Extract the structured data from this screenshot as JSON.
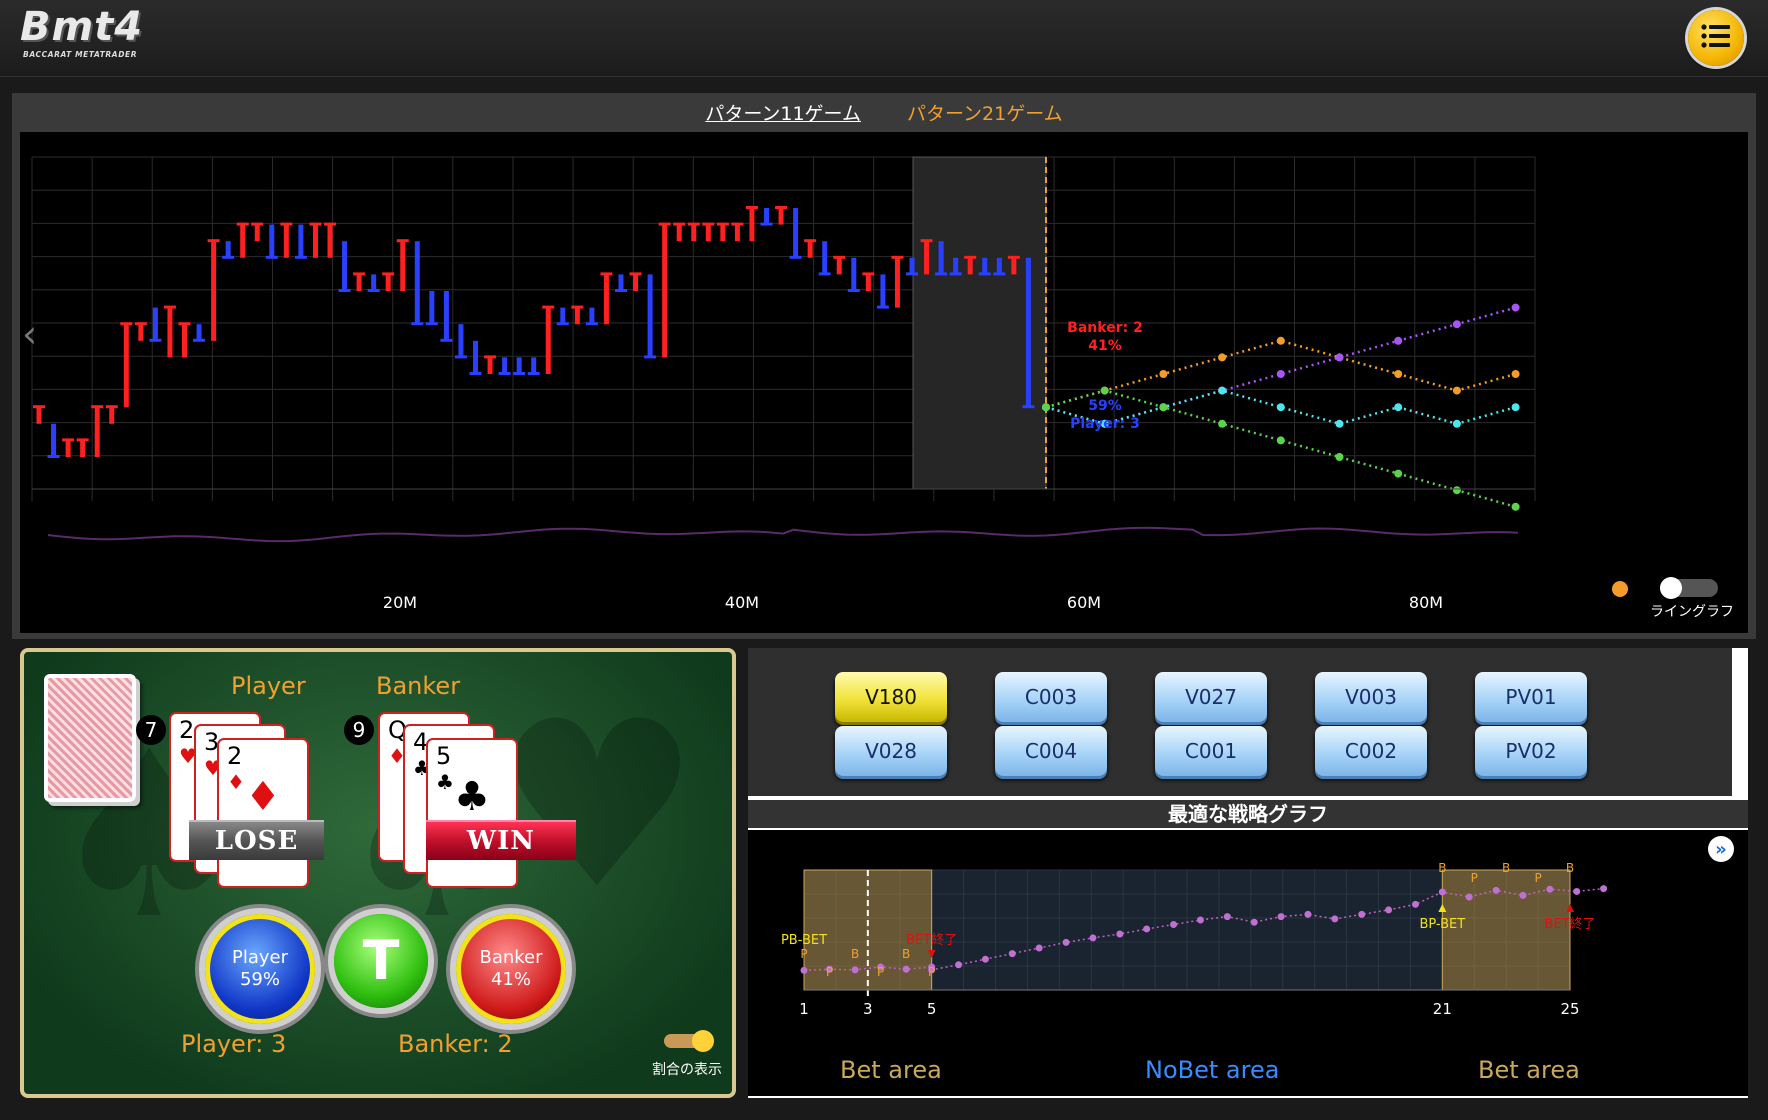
{
  "app": {
    "logo_main": "Bmt4",
    "logo_sub": "BACCARAT METATRADER",
    "menu_icon": "menu-list-icon"
  },
  "top_chart": {
    "tabs": [
      {
        "label": "パターン11ゲーム",
        "active": true
      },
      {
        "label": "パターン21ゲーム",
        "active": false
      }
    ],
    "x_ticks": [
      "20M",
      "40M",
      "60M",
      "80M"
    ],
    "toggle_label": "ライングラフ",
    "banker_annotation": {
      "name": "Banker: 2",
      "pct": "41%"
    },
    "player_annotation": {
      "pct": "59%",
      "name": "Player: 3"
    },
    "colors": {
      "banker": "#ff2020",
      "player": "#2a40ff",
      "orange": "#f39c2a",
      "purple": "#a855f7",
      "cyan": "#4ee6ec",
      "green": "#5bd34a"
    }
  },
  "chart_data": {
    "type": "line",
    "bars": [
      {
        "c": "r",
        "lo": 6,
        "hi": 7
      },
      {
        "c": "b",
        "lo": 4,
        "hi": 6
      },
      {
        "c": "r",
        "lo": 4,
        "hi": 5
      },
      {
        "c": "r",
        "lo": 4,
        "hi": 5
      },
      {
        "c": "r",
        "lo": 4,
        "hi": 7
      },
      {
        "c": "r",
        "lo": 6,
        "hi": 7
      },
      {
        "c": "r",
        "lo": 7,
        "hi": 12
      },
      {
        "c": "r",
        "lo": 11,
        "hi": 12
      },
      {
        "c": "b",
        "lo": 11,
        "hi": 13
      },
      {
        "c": "r",
        "lo": 10,
        "hi": 13
      },
      {
        "c": "r",
        "lo": 10,
        "hi": 12
      },
      {
        "c": "b",
        "lo": 11,
        "hi": 12
      },
      {
        "c": "r",
        "lo": 11,
        "hi": 17
      },
      {
        "c": "b",
        "lo": 16,
        "hi": 17
      },
      {
        "c": "r",
        "lo": 16,
        "hi": 18
      },
      {
        "c": "r",
        "lo": 17,
        "hi": 18
      },
      {
        "c": "b",
        "lo": 16,
        "hi": 18
      },
      {
        "c": "r",
        "lo": 16,
        "hi": 18
      },
      {
        "c": "b",
        "lo": 16,
        "hi": 18
      },
      {
        "c": "r",
        "lo": 16,
        "hi": 18
      },
      {
        "c": "r",
        "lo": 16,
        "hi": 18
      },
      {
        "c": "b",
        "lo": 14,
        "hi": 17
      },
      {
        "c": "r",
        "lo": 14,
        "hi": 15
      },
      {
        "c": "b",
        "lo": 14,
        "hi": 15
      },
      {
        "c": "r",
        "lo": 14,
        "hi": 15
      },
      {
        "c": "r",
        "lo": 14,
        "hi": 17
      },
      {
        "c": "b",
        "lo": 12,
        "hi": 17
      },
      {
        "c": "b",
        "lo": 12,
        "hi": 14
      },
      {
        "c": "b",
        "lo": 11,
        "hi": 14
      },
      {
        "c": "b",
        "lo": 10,
        "hi": 12
      },
      {
        "c": "b",
        "lo": 9,
        "hi": 11
      },
      {
        "c": "r",
        "lo": 9,
        "hi": 10
      },
      {
        "c": "b",
        "lo": 9,
        "hi": 10
      },
      {
        "c": "b",
        "lo": 9,
        "hi": 10
      },
      {
        "c": "b",
        "lo": 9,
        "hi": 10
      },
      {
        "c": "r",
        "lo": 9,
        "hi": 13
      },
      {
        "c": "b",
        "lo": 12,
        "hi": 13
      },
      {
        "c": "r",
        "lo": 12,
        "hi": 13
      },
      {
        "c": "b",
        "lo": 12,
        "hi": 13
      },
      {
        "c": "r",
        "lo": 12,
        "hi": 15
      },
      {
        "c": "b",
        "lo": 14,
        "hi": 15
      },
      {
        "c": "r",
        "lo": 14,
        "hi": 15
      },
      {
        "c": "b",
        "lo": 10,
        "hi": 15
      },
      {
        "c": "r",
        "lo": 10,
        "hi": 18
      },
      {
        "c": "r",
        "lo": 17,
        "hi": 18
      },
      {
        "c": "r",
        "lo": 17,
        "hi": 18
      },
      {
        "c": "r",
        "lo": 17,
        "hi": 18
      },
      {
        "c": "r",
        "lo": 17,
        "hi": 18
      },
      {
        "c": "r",
        "lo": 17,
        "hi": 18
      },
      {
        "c": "r",
        "lo": 17,
        "hi": 19
      },
      {
        "c": "b",
        "lo": 18,
        "hi": 19
      },
      {
        "c": "r",
        "lo": 18,
        "hi": 19
      },
      {
        "c": "b",
        "lo": 16,
        "hi": 19
      },
      {
        "c": "r",
        "lo": 16,
        "hi": 17
      },
      {
        "c": "b",
        "lo": 15,
        "hi": 17
      },
      {
        "c": "r",
        "lo": 15,
        "hi": 16
      },
      {
        "c": "b",
        "lo": 14,
        "hi": 16
      },
      {
        "c": "r",
        "lo": 14,
        "hi": 15
      },
      {
        "c": "b",
        "lo": 13,
        "hi": 15
      },
      {
        "c": "r",
        "lo": 13,
        "hi": 16
      },
      {
        "c": "b",
        "lo": 15,
        "hi": 16
      },
      {
        "c": "r",
        "lo": 15,
        "hi": 17
      },
      {
        "c": "b",
        "lo": 15,
        "hi": 17
      },
      {
        "c": "b",
        "lo": 15,
        "hi": 16
      },
      {
        "c": "r",
        "lo": 15,
        "hi": 16
      },
      {
        "c": "b",
        "lo": 15,
        "hi": 16
      },
      {
        "c": "b",
        "lo": 15,
        "hi": 16
      },
      {
        "c": "r",
        "lo": 15,
        "hi": 16
      },
      {
        "c": "b",
        "lo": 7,
        "hi": 16
      }
    ],
    "projections": [
      {
        "name": "orange",
        "values": [
          7.0,
          8.0,
          9.0,
          10.0,
          11.0,
          10.0,
          9.0,
          8.0,
          9.0
        ]
      },
      {
        "name": "purple",
        "values": [
          7.0,
          6.0,
          7.0,
          8.0,
          9.0,
          10.0,
          11.0,
          12.0,
          13.0
        ]
      },
      {
        "name": "cyan",
        "values": [
          7.0,
          6.0,
          7.0,
          8.0,
          7.0,
          6.0,
          7.0,
          6.0,
          7.0
        ]
      },
      {
        "name": "green",
        "values": [
          7.0,
          8.0,
          7.0,
          6.0,
          5.0,
          4.0,
          3.0,
          2.0,
          1.0
        ]
      }
    ]
  },
  "game": {
    "player_label": "Player",
    "banker_label": "Banker",
    "player_score": "7",
    "banker_score": "9",
    "player_cards": [
      {
        "rank": "2",
        "suit": "♥",
        "color": "red"
      },
      {
        "rank": "3",
        "suit": "♥",
        "color": "red"
      },
      {
        "rank": "2",
        "suit": "♦",
        "color": "red"
      }
    ],
    "banker_cards": [
      {
        "rank": "Q",
        "suit": "♦",
        "color": "red"
      },
      {
        "rank": "4",
        "suit": "♣",
        "color": "blk"
      },
      {
        "rank": "5",
        "suit": "♣",
        "color": "blk"
      }
    ],
    "player_result": "LOSE",
    "banker_result": "WIN",
    "orb_player_name": "Player",
    "orb_player_pct": "59%",
    "orb_tie": "T",
    "orb_banker_name": "Banker",
    "orb_banker_pct": "41%",
    "player_count": "Player: 3",
    "banker_count": "Banker: 2",
    "ratio_toggle_label": "割合の表示"
  },
  "strategy": {
    "buttons": [
      "V180",
      "C003",
      "V027",
      "V003",
      "PV01",
      "V028",
      "C004",
      "C001",
      "C002",
      "PV02"
    ],
    "active_button": "V180",
    "title": "最適な戦略グラフ",
    "x_labels": [
      "1",
      "3",
      "5",
      "21",
      "25"
    ],
    "areas": [
      "Bet area",
      "NoBet area",
      "Bet area"
    ],
    "annotations": {
      "pb_bet": "PB-BET",
      "bet_end_1": "BET終了",
      "bp_bet": "BP-BET",
      "bet_end_2": "BET終了"
    },
    "point_letters_left": [
      "P",
      "P",
      "B",
      "P",
      "B",
      "P"
    ],
    "point_letters_right": [
      "B",
      "P",
      "B",
      "P",
      "B"
    ],
    "series": [
      5,
      5.2,
      5.1,
      5.6,
      5.2,
      5.6,
      5.1,
      6,
      7,
      8,
      9,
      10,
      10.8,
      11.5,
      12.4,
      13.2,
      14,
      14.6,
      13.6,
      14.6,
      15,
      14.2,
      15,
      15.8,
      16.8,
      19,
      18.1,
      19.3,
      18.4,
      19.5,
      19.1,
      19.6
    ]
  }
}
